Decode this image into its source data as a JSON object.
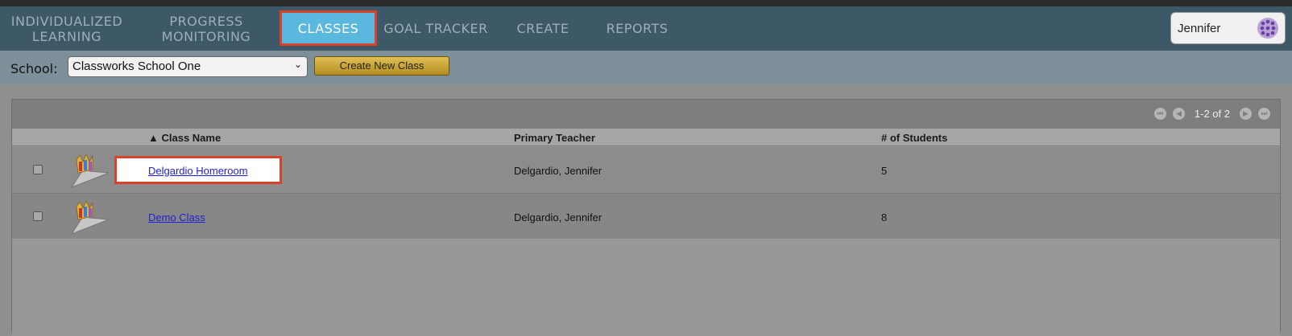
{
  "nav": {
    "items": [
      {
        "line1": "INDIVIDUALIZED",
        "line2": "LEARNING"
      },
      {
        "line1": "PROGRESS",
        "line2": "MONITORING"
      },
      {
        "label": "CLASSES"
      },
      {
        "label": "GOAL TRACKER"
      },
      {
        "label": "CREATE"
      },
      {
        "label": "REPORTS"
      }
    ],
    "user": "Jennifer"
  },
  "toolbar": {
    "school_label": "School:",
    "school_selected": "Classworks School One",
    "create_button": "Create New Class"
  },
  "table": {
    "pager_text": "1-2 of 2",
    "columns": [
      "▲ Class Name",
      "Primary Teacher",
      "# of Students"
    ],
    "rows": [
      {
        "name": "Delgardio Homeroom",
        "teacher": "Delgardio, Jennifer",
        "students": "5"
      },
      {
        "name": "Demo Class",
        "teacher": "Delgardio, Jennifer",
        "students": "8"
      }
    ]
  },
  "colors": {
    "nav_bg": "#3d5866",
    "active_tab": "#5ab7dd",
    "highlight_border": "#d9412b",
    "button_gold": "#c9a235"
  }
}
